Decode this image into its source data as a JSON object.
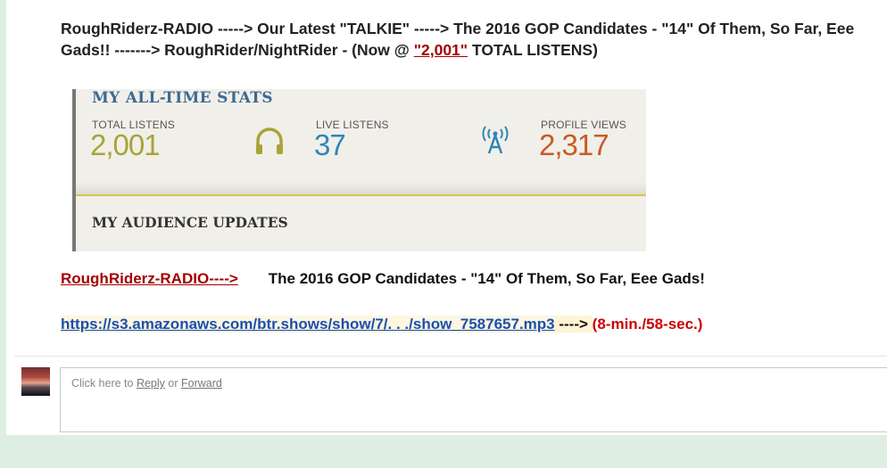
{
  "heading": {
    "line1": "RoughRiderz-RADIO -----> Our Latest \"TALKIE\" -----> The 2016 GOP Candidates - \"14\" Of Them, So Far, Eee",
    "line2_prefix": "Gads!! -------> RoughRider/NightRider - (Now @ ",
    "line2_link": "\"2,001\"",
    "line2_suffix": " TOTAL LISTENS)"
  },
  "stats": {
    "title": "MY ALL-TIME STATS",
    "total_label": "TOTAL LISTENS",
    "total_value": "2,001",
    "live_label": "LIVE LISTENS",
    "live_value": "37",
    "profile_label": "PROFILE VIEWS",
    "profile_value": "2,317",
    "audience_title": "MY AUDIENCE UPDATES",
    "colors": {
      "total": "#a7a537",
      "live": "#2f86b6",
      "profile": "#c85b21"
    }
  },
  "show": {
    "brand_link": "RoughRiderz-RADIO---->",
    "title": "The 2016 GOP Candidates - \"14\" Of Them, So Far, Eee Gads!",
    "url": "https://s3.amazonaws.com/btr.shows/show/7/. . ./show_7587657.mp3",
    "arrow": " ----> ",
    "duration": "(8-min./58-sec.)"
  },
  "reply": {
    "prefix": "Click here to ",
    "reply_link": "Reply",
    "or": " or ",
    "forward_link": "Forward"
  }
}
